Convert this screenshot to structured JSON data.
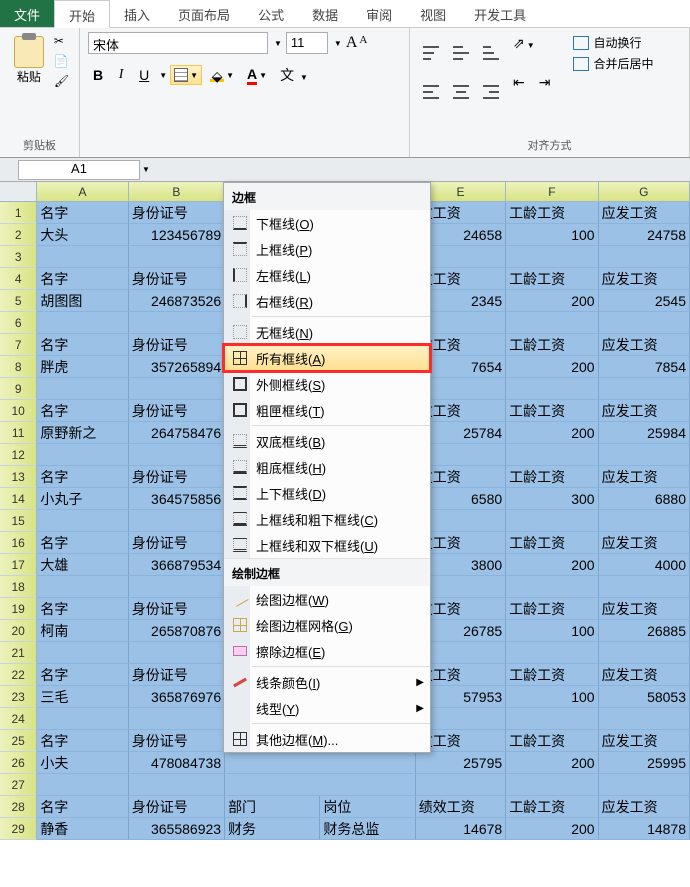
{
  "tabs": {
    "file": "文件",
    "home": "开始",
    "insert": "插入",
    "layout": "页面布局",
    "formula": "公式",
    "data": "数据",
    "review": "审阅",
    "view": "视图",
    "dev": "开发工具"
  },
  "ribbon": {
    "clipboard": {
      "paste": "粘贴",
      "title": "剪贴板"
    },
    "font": {
      "name": "宋体",
      "size": "11",
      "bold": "B",
      "italic": "I",
      "underline": "U",
      "title": "字体"
    },
    "align": {
      "wrap": "自动换行",
      "merge": "合并后居中",
      "title": "对齐方式"
    }
  },
  "namebox": "A1",
  "columns": [
    "A",
    "B",
    "E",
    "F",
    "G"
  ],
  "menu": {
    "section1": "边框",
    "items1": [
      {
        "icon": "bottom",
        "label": "下框线(O)"
      },
      {
        "icon": "top",
        "label": "上框线(P)"
      },
      {
        "icon": "left",
        "label": "左框线(L)"
      },
      {
        "icon": "right",
        "label": "右框线(R)"
      },
      {
        "icon": "none",
        "label": "无框线(N)"
      },
      {
        "icon": "all",
        "label": "所有框线(A)"
      },
      {
        "icon": "out",
        "label": "外侧框线(S)"
      },
      {
        "icon": "thick",
        "label": "粗匣框线(T)"
      },
      {
        "icon": "dblb",
        "label": "双底框线(B)"
      },
      {
        "icon": "thkb",
        "label": "粗底框线(H)"
      },
      {
        "icon": "tb",
        "label": "上下框线(D)"
      },
      {
        "icon": "tthkb",
        "label": "上框线和粗下框线(C)"
      },
      {
        "icon": "tdblb",
        "label": "上框线和双下框线(U)"
      }
    ],
    "section2": "绘制边框",
    "items2": [
      {
        "icon": "draw",
        "label": "绘图边框(W)"
      },
      {
        "icon": "grid",
        "label": "绘图边框网格(G)"
      },
      {
        "icon": "erase",
        "label": "擦除边框(E)"
      },
      {
        "icon": "pen",
        "label": "线条颜色(I)",
        "sub": true
      },
      {
        "icon": "",
        "label": "线型(Y)",
        "sub": true
      },
      {
        "icon": "other",
        "label": "其他边框(M)..."
      }
    ]
  },
  "sheet": {
    "rows": [
      {
        "n": 1,
        "A": "名字",
        "B": "身份证号",
        "E": "攻工资",
        "F": "工龄工资",
        "G": "应发工资"
      },
      {
        "n": 2,
        "A": "大头",
        "B": "123456789",
        "E": "24658",
        "F": "100",
        "G": "24758"
      },
      {
        "n": 3,
        "A": "",
        "B": "",
        "E": "",
        "F": "",
        "G": ""
      },
      {
        "n": 4,
        "A": "名字",
        "B": "身份证号",
        "E": "攻工资",
        "F": "工龄工资",
        "G": "应发工资"
      },
      {
        "n": 5,
        "A": "胡图图",
        "B": "246873526",
        "E": "2345",
        "F": "200",
        "G": "2545"
      },
      {
        "n": 6,
        "A": "",
        "B": "",
        "E": "",
        "F": "",
        "G": ""
      },
      {
        "n": 7,
        "A": "名字",
        "B": "身份证号",
        "E": "攻工资",
        "F": "工龄工资",
        "G": "应发工资"
      },
      {
        "n": 8,
        "A": "胖虎",
        "B": "357265894",
        "E": "7654",
        "F": "200",
        "G": "7854"
      },
      {
        "n": 9,
        "A": "",
        "B": "",
        "E": "",
        "F": "",
        "G": ""
      },
      {
        "n": 10,
        "A": "名字",
        "B": "身份证号",
        "E": "攻工资",
        "F": "工龄工资",
        "G": "应发工资"
      },
      {
        "n": 11,
        "A": "原野新之",
        "B": "264758476",
        "E": "25784",
        "F": "200",
        "G": "25984"
      },
      {
        "n": 12,
        "A": "",
        "B": "",
        "E": "",
        "F": "",
        "G": ""
      },
      {
        "n": 13,
        "A": "名字",
        "B": "身份证号",
        "E": "攻工资",
        "F": "工龄工资",
        "G": "应发工资"
      },
      {
        "n": 14,
        "A": "小丸子",
        "B": "364575856",
        "E": "6580",
        "F": "300",
        "G": "6880"
      },
      {
        "n": 15,
        "A": "",
        "B": "",
        "E": "",
        "F": "",
        "G": ""
      },
      {
        "n": 16,
        "A": "名字",
        "B": "身份证号",
        "E": "攻工资",
        "F": "工龄工资",
        "G": "应发工资"
      },
      {
        "n": 17,
        "A": "大雄",
        "B": "366879534",
        "E": "3800",
        "F": "200",
        "G": "4000"
      },
      {
        "n": 18,
        "A": "",
        "B": "",
        "E": "",
        "F": "",
        "G": ""
      },
      {
        "n": 19,
        "A": "名字",
        "B": "身份证号",
        "E": "攻工资",
        "F": "工龄工资",
        "G": "应发工资"
      },
      {
        "n": 20,
        "A": "柯南",
        "B": "265870876",
        "E": "26785",
        "F": "100",
        "G": "26885"
      },
      {
        "n": 21,
        "A": "",
        "B": "",
        "E": "",
        "F": "",
        "G": ""
      },
      {
        "n": 22,
        "A": "名字",
        "B": "身份证号",
        "E": "攻工资",
        "F": "工龄工资",
        "G": "应发工资"
      },
      {
        "n": 23,
        "A": "三毛",
        "B": "365876976",
        "E": "57953",
        "F": "100",
        "G": "58053"
      },
      {
        "n": 24,
        "A": "",
        "B": "",
        "E": "",
        "F": "",
        "G": ""
      },
      {
        "n": 25,
        "A": "名字",
        "B": "身份证号",
        "E": "攻工资",
        "F": "工龄工资",
        "G": "应发工资"
      },
      {
        "n": 26,
        "A": "小夫",
        "B": "478084738",
        "E": "25795",
        "F": "200",
        "G": "25995"
      },
      {
        "n": 27,
        "A": "",
        "B": "",
        "E": "",
        "F": "",
        "G": ""
      },
      {
        "n": 28,
        "A": "名字",
        "B": "身份证号",
        "C": "部门",
        "D": "岗位",
        "E": "绩效工资",
        "F": "工龄工资",
        "G": "应发工资"
      },
      {
        "n": 29,
        "A": "静香",
        "B": "365586923",
        "C": "财务",
        "D": "财务总监",
        "E": "14678",
        "F": "200",
        "G": "14878"
      }
    ]
  }
}
